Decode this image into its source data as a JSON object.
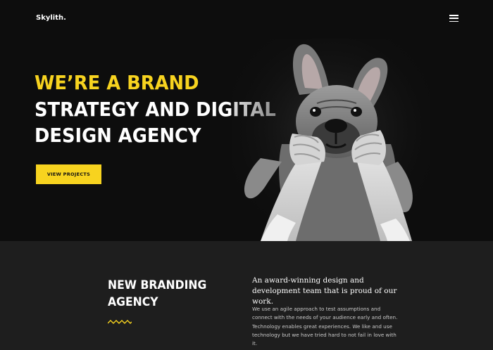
{
  "header": {
    "logo": "Skylith.",
    "menu_icon": "hamburger-menu-icon"
  },
  "hero": {
    "title_line1": "WE’RE A BRAND",
    "title_line2": "STRATEGY AND DIGITAL",
    "title_line3": "DESIGN AGENCY",
    "cta_label": "VIEW PROJECTS",
    "image": "dog-photo"
  },
  "about": {
    "title_line1": "NEW BRANDING",
    "title_line2": "AGENCY",
    "zigzag_icon": "zigzag-divider-icon",
    "lead": "An award-winning design and development team that is proud of our work.",
    "body": "We use an agile approach to test assumptions and connect with the needs of your audience early and often. Technology enables great experiences. We like and use technology but we have tried hard to not fail in love with it."
  },
  "colors": {
    "accent": "#f7d31f",
    "hero_bg": "#0d0d0d",
    "section_bg": "#1e1e1e",
    "text": "#ffffff",
    "muted_text": "#c9c9c9"
  }
}
